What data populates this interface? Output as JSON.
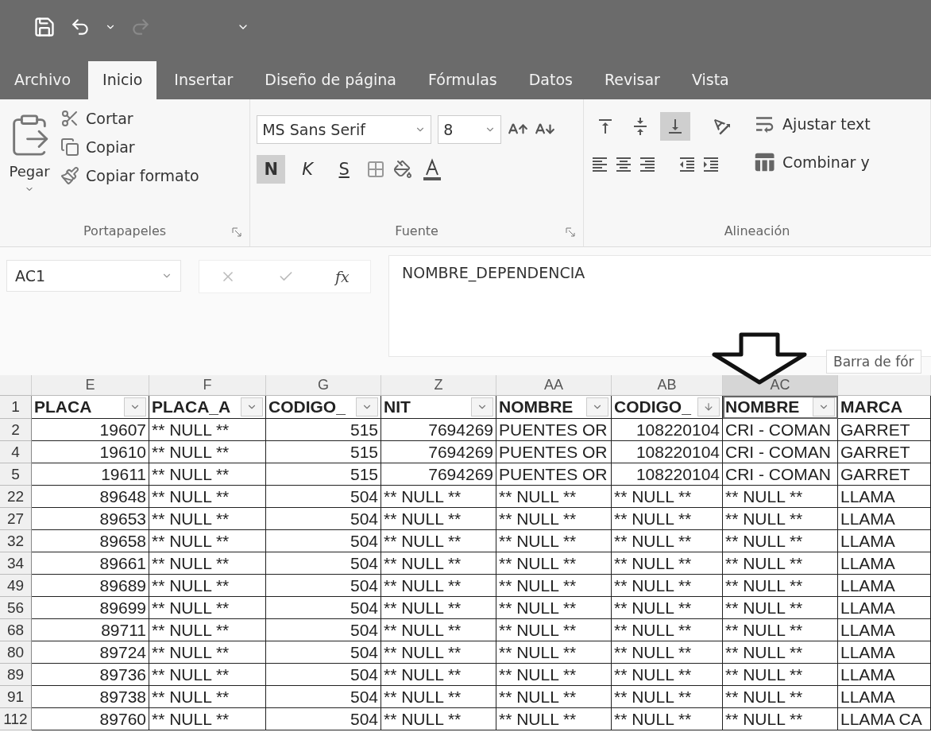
{
  "quick_access": {
    "redo": {
      "disabled": true
    }
  },
  "tabs": [
    {
      "label": "Archivo",
      "selected": false
    },
    {
      "label": "Inicio",
      "selected": true
    },
    {
      "label": "Insertar",
      "selected": false
    },
    {
      "label": "Diseño de página",
      "selected": false
    },
    {
      "label": "Fórmulas",
      "selected": false
    },
    {
      "label": "Datos",
      "selected": false
    },
    {
      "label": "Revisar",
      "selected": false
    },
    {
      "label": "Vista",
      "selected": false
    }
  ],
  "ribbon": {
    "clipboard": {
      "label": "Portapapeles",
      "paste": "Pegar",
      "items": [
        "Cortar",
        "Copiar",
        "Copiar formato"
      ]
    },
    "font": {
      "label": "Fuente",
      "family": "MS Sans Serif",
      "size": "8",
      "styles": [
        {
          "text": "N",
          "on": true
        },
        {
          "text": "K",
          "on": false
        },
        {
          "text": "S",
          "on": false
        }
      ]
    },
    "alignment": {
      "label": "Alineación",
      "vertical": [
        {
          "on": false
        },
        {
          "on": false
        },
        {
          "on": true
        }
      ],
      "wrap": "Ajustar text",
      "merge": "Combinar y"
    }
  },
  "formula_bar": {
    "name_box": "AC1",
    "function_label": "fx",
    "formula": "NOMBRE_DEPENDENCIA",
    "tooltip": "Barra de fór"
  },
  "grid": {
    "columns": [
      {
        "letter": "E",
        "selected": false
      },
      {
        "letter": "F",
        "selected": false
      },
      {
        "letter": "G",
        "selected": false
      },
      {
        "letter": "Z",
        "selected": false
      },
      {
        "letter": "AA",
        "selected": false
      },
      {
        "letter": "AB",
        "selected": false
      },
      {
        "letter": "AC",
        "selected": true
      }
    ],
    "header_row": {
      "number": "1",
      "cells": [
        {
          "text": "PLACA",
          "filter_button": true,
          "sorted": false,
          "selected": false
        },
        {
          "text": "PLACA_A",
          "filter_button": true,
          "sorted": false,
          "selected": false
        },
        {
          "text": "CODIGO_",
          "filter_button": true,
          "sorted": false,
          "selected": false
        },
        {
          "text": "NIT",
          "filter_button": true,
          "sorted": false,
          "selected": false
        },
        {
          "text": "NOMBRE",
          "filter_button": true,
          "sorted": false,
          "selected": false
        },
        {
          "text": "CODIGO_",
          "filter_button": true,
          "sorted": true,
          "selected": false
        },
        {
          "text": "NOMBRE",
          "filter_button": true,
          "sorted": false,
          "selected": true
        },
        {
          "text": "MARCA",
          "selected": false
        }
      ]
    },
    "rows": [
      {
        "number": "2",
        "cells": [
          {
            "text": "19607",
            "kind": "num"
          },
          {
            "text": "** NULL **",
            "kind": "text"
          },
          {
            "text": "515",
            "kind": "num"
          },
          {
            "text": "7694269",
            "kind": "num"
          },
          {
            "text": "PUENTES OR",
            "kind": "text"
          },
          {
            "text": "108220104",
            "kind": "num"
          },
          {
            "text": "CRI - COMAN",
            "kind": "text"
          },
          {
            "text": "GARRET",
            "kind": "text"
          }
        ]
      },
      {
        "number": "4",
        "cells": [
          {
            "text": "19610",
            "kind": "num"
          },
          {
            "text": "** NULL **",
            "kind": "text"
          },
          {
            "text": "515",
            "kind": "num"
          },
          {
            "text": "7694269",
            "kind": "num"
          },
          {
            "text": "PUENTES OR",
            "kind": "text"
          },
          {
            "text": "108220104",
            "kind": "num"
          },
          {
            "text": "CRI - COMAN",
            "kind": "text"
          },
          {
            "text": "GARRET",
            "kind": "text"
          }
        ]
      },
      {
        "number": "5",
        "cells": [
          {
            "text": "19611",
            "kind": "num"
          },
          {
            "text": "** NULL **",
            "kind": "text"
          },
          {
            "text": "515",
            "kind": "num"
          },
          {
            "text": "7694269",
            "kind": "num"
          },
          {
            "text": "PUENTES OR",
            "kind": "text"
          },
          {
            "text": "108220104",
            "kind": "num"
          },
          {
            "text": "CRI - COMAN",
            "kind": "text"
          },
          {
            "text": "GARRET",
            "kind": "text"
          }
        ]
      },
      {
        "number": "22",
        "cells": [
          {
            "text": "89648",
            "kind": "num"
          },
          {
            "text": "** NULL **",
            "kind": "text"
          },
          {
            "text": "504",
            "kind": "num"
          },
          {
            "text": "** NULL **",
            "kind": "text"
          },
          {
            "text": "** NULL **",
            "kind": "text"
          },
          {
            "text": "** NULL **",
            "kind": "text"
          },
          {
            "text": "** NULL **",
            "kind": "text"
          },
          {
            "text": "LLAMA",
            "kind": "text"
          }
        ]
      },
      {
        "number": "27",
        "cells": [
          {
            "text": "89653",
            "kind": "num"
          },
          {
            "text": "** NULL **",
            "kind": "text"
          },
          {
            "text": "504",
            "kind": "num"
          },
          {
            "text": "** NULL **",
            "kind": "text"
          },
          {
            "text": "** NULL **",
            "kind": "text"
          },
          {
            "text": "** NULL **",
            "kind": "text"
          },
          {
            "text": "** NULL **",
            "kind": "text"
          },
          {
            "text": "LLAMA",
            "kind": "text"
          }
        ]
      },
      {
        "number": "32",
        "cells": [
          {
            "text": "89658",
            "kind": "num"
          },
          {
            "text": "** NULL **",
            "kind": "text"
          },
          {
            "text": "504",
            "kind": "num"
          },
          {
            "text": "** NULL **",
            "kind": "text"
          },
          {
            "text": "** NULL **",
            "kind": "text"
          },
          {
            "text": "** NULL **",
            "kind": "text"
          },
          {
            "text": "** NULL **",
            "kind": "text"
          },
          {
            "text": "LLAMA",
            "kind": "text"
          }
        ]
      },
      {
        "number": "34",
        "cells": [
          {
            "text": "89661",
            "kind": "num"
          },
          {
            "text": "** NULL **",
            "kind": "text"
          },
          {
            "text": "504",
            "kind": "num"
          },
          {
            "text": "** NULL **",
            "kind": "text"
          },
          {
            "text": "** NULL **",
            "kind": "text"
          },
          {
            "text": "** NULL **",
            "kind": "text"
          },
          {
            "text": "** NULL **",
            "kind": "text"
          },
          {
            "text": "LLAMA",
            "kind": "text"
          }
        ]
      },
      {
        "number": "49",
        "cells": [
          {
            "text": "89689",
            "kind": "num"
          },
          {
            "text": "** NULL **",
            "kind": "text"
          },
          {
            "text": "504",
            "kind": "num"
          },
          {
            "text": "** NULL **",
            "kind": "text"
          },
          {
            "text": "** NULL **",
            "kind": "text"
          },
          {
            "text": "** NULL **",
            "kind": "text"
          },
          {
            "text": "** NULL **",
            "kind": "text"
          },
          {
            "text": "LLAMA",
            "kind": "text"
          }
        ]
      },
      {
        "number": "56",
        "cells": [
          {
            "text": "89699",
            "kind": "num"
          },
          {
            "text": "** NULL **",
            "kind": "text"
          },
          {
            "text": "504",
            "kind": "num"
          },
          {
            "text": "** NULL **",
            "kind": "text"
          },
          {
            "text": "** NULL **",
            "kind": "text"
          },
          {
            "text": "** NULL **",
            "kind": "text"
          },
          {
            "text": "** NULL **",
            "kind": "text"
          },
          {
            "text": "LLAMA",
            "kind": "text"
          }
        ]
      },
      {
        "number": "68",
        "cells": [
          {
            "text": "89711",
            "kind": "num"
          },
          {
            "text": "** NULL **",
            "kind": "text"
          },
          {
            "text": "504",
            "kind": "num"
          },
          {
            "text": "** NULL **",
            "kind": "text"
          },
          {
            "text": "** NULL **",
            "kind": "text"
          },
          {
            "text": "** NULL **",
            "kind": "text"
          },
          {
            "text": "** NULL **",
            "kind": "text"
          },
          {
            "text": "LLAMA",
            "kind": "text"
          }
        ]
      },
      {
        "number": "80",
        "cells": [
          {
            "text": "89724",
            "kind": "num"
          },
          {
            "text": "** NULL **",
            "kind": "text"
          },
          {
            "text": "504",
            "kind": "num"
          },
          {
            "text": "** NULL **",
            "kind": "text"
          },
          {
            "text": "** NULL **",
            "kind": "text"
          },
          {
            "text": "** NULL **",
            "kind": "text"
          },
          {
            "text": "** NULL **",
            "kind": "text"
          },
          {
            "text": "LLAMA",
            "kind": "text"
          }
        ]
      },
      {
        "number": "89",
        "cells": [
          {
            "text": "89736",
            "kind": "num"
          },
          {
            "text": "** NULL **",
            "kind": "text"
          },
          {
            "text": "504",
            "kind": "num"
          },
          {
            "text": "** NULL **",
            "kind": "text"
          },
          {
            "text": "** NULL **",
            "kind": "text"
          },
          {
            "text": "** NULL **",
            "kind": "text"
          },
          {
            "text": "** NULL **",
            "kind": "text"
          },
          {
            "text": "LLAMA",
            "kind": "text"
          }
        ]
      },
      {
        "number": "91",
        "cells": [
          {
            "text": "89738",
            "kind": "num"
          },
          {
            "text": "** NULL **",
            "kind": "text"
          },
          {
            "text": "504",
            "kind": "num"
          },
          {
            "text": "** NULL **",
            "kind": "text"
          },
          {
            "text": "** NULL **",
            "kind": "text"
          },
          {
            "text": "** NULL **",
            "kind": "text"
          },
          {
            "text": "** NULL **",
            "kind": "text"
          },
          {
            "text": "LLAMA",
            "kind": "text"
          }
        ]
      },
      {
        "number": "112",
        "cells": [
          {
            "text": "89760",
            "kind": "num"
          },
          {
            "text": "** NULL **",
            "kind": "text"
          },
          {
            "text": "504",
            "kind": "num"
          },
          {
            "text": "** NULL **",
            "kind": "text"
          },
          {
            "text": "** NULL **",
            "kind": "text"
          },
          {
            "text": "** NULL **",
            "kind": "text"
          },
          {
            "text": "** NULL **",
            "kind": "text"
          },
          {
            "text": "LLAMA CA",
            "kind": "text"
          }
        ]
      }
    ]
  }
}
